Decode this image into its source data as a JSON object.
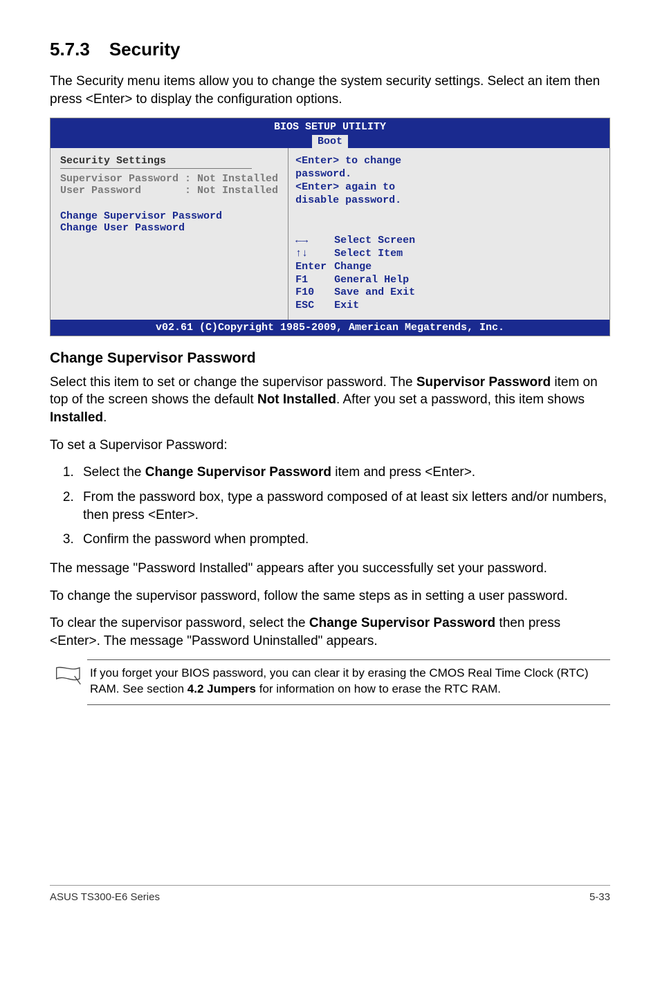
{
  "section": {
    "number": "5.7.3",
    "title": "Security",
    "intro": "The Security menu items allow you to change the system security settings. Select an item then press <Enter> to display the configuration options."
  },
  "bios": {
    "header_title": "BIOS SETUP UTILITY",
    "tab": "Boot",
    "left": {
      "heading": "Security Settings",
      "rows": [
        "Supervisor Password : Not Installed",
        "User Password       : Not Installed"
      ],
      "actions": [
        "Change Supervisor Password",
        "Change User Password"
      ]
    },
    "right": {
      "help": "<Enter> to change password.\n<Enter> again to disable password.",
      "nav": [
        {
          "key": "←→",
          "label": "Select Screen"
        },
        {
          "key": "↑↓",
          "label": "Select Item"
        },
        {
          "key": "Enter",
          "label": "Change"
        },
        {
          "key": "F1",
          "label": "General Help"
        },
        {
          "key": "F10",
          "label": "Save and Exit"
        },
        {
          "key": "ESC",
          "label": "Exit"
        }
      ]
    },
    "footer": "v02.61 (C)Copyright 1985-2009, American Megatrends, Inc."
  },
  "subsection": {
    "title": "Change Supervisor Password",
    "p1_a": "Select this item to set or change the supervisor password. The ",
    "p1_b": "Supervisor Password",
    "p1_c": " item on top of the screen shows the default ",
    "p1_d": "Not Installed",
    "p1_e": ". After you set a password, this item shows ",
    "p1_f": "Installed",
    "p1_g": ".",
    "p2": "To set a Supervisor Password:",
    "steps": {
      "s1_a": "Select the ",
      "s1_b": "Change Supervisor Password",
      "s1_c": " item and press <Enter>.",
      "s2": "From the password box, type a password composed of at least six letters and/or numbers, then press <Enter>.",
      "s3": "Confirm the password when prompted."
    },
    "p3": "The message \"Password Installed\" appears after you successfully set your password.",
    "p4": "To change the supervisor password, follow the same steps as in setting a user password.",
    "p5_a": "To clear the supervisor password, select the ",
    "p5_b": "Change Supervisor Password",
    "p5_c": " then press <Enter>. The message \"Password Uninstalled\" appears."
  },
  "note": {
    "text_a": "If you forget your BIOS password, you can clear it by erasing the CMOS Real Time Clock (RTC) RAM. See section ",
    "text_b": "4.2 Jumpers",
    "text_c": " for information on how to erase the RTC RAM."
  },
  "footer": {
    "left": "ASUS TS300-E6 Series",
    "right": "5-33"
  }
}
